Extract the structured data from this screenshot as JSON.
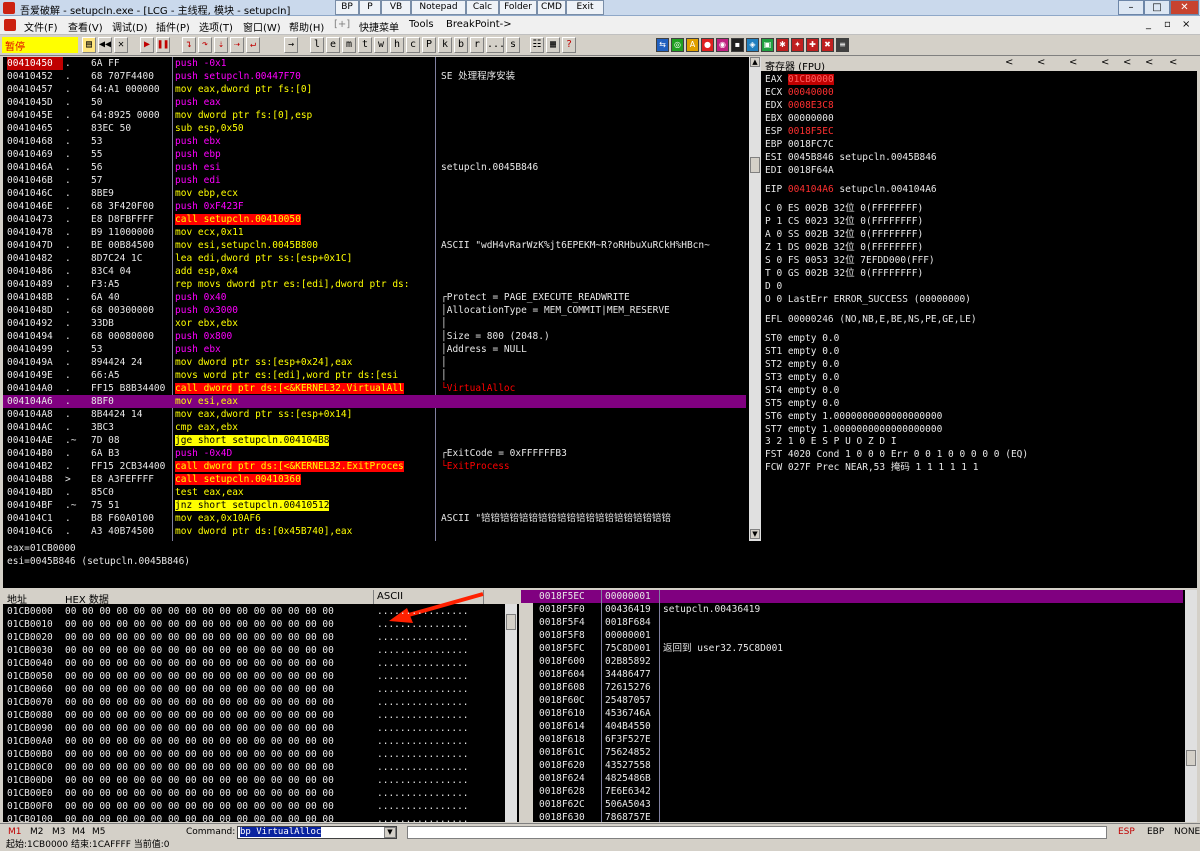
{
  "window": {
    "title": "吾爱破解 - setupcln.exe - [LCG - 主线程, 模块 - setupcln]",
    "quick_buttons": [
      "BP",
      "P",
      "VB",
      "Notepad",
      "Calc",
      "Folder",
      "CMD",
      "Exit"
    ],
    "controls": [
      "–",
      "□",
      "✕"
    ],
    "child_controls": [
      "_",
      "▫",
      "×"
    ]
  },
  "menu": [
    "文件(F)",
    "查看(V)",
    "调试(D)",
    "插件(P)",
    "选项(T)",
    "窗口(W)",
    "帮助(H)",
    "[+]",
    "快捷菜单",
    "Tools",
    "BreakPoint->"
  ],
  "toolbar": {
    "state": "暂停",
    "letters": [
      "l",
      "e",
      "m",
      "t",
      "w",
      "h",
      "c",
      "P",
      "k",
      "b",
      "r",
      "...",
      "s"
    ]
  },
  "disasm": [
    {
      "addr": "00410450",
      "mark": ".",
      "hex": "6A FF",
      "dis": "push -0x1",
      "type": "push",
      "cmt": "",
      "eip": true
    },
    {
      "addr": "00410452",
      "mark": ".",
      "hex": "68 707F4400",
      "dis": "push setupcln.00447F70",
      "type": "push",
      "cmt": "SE 处理程序安装"
    },
    {
      "addr": "00410457",
      "mark": ".",
      "hex": "64:A1 000000",
      "dis": "mov eax,dword ptr fs:[0]",
      "type": "mov",
      "cmt": ""
    },
    {
      "addr": "0041045D",
      "mark": ".",
      "hex": "50",
      "dis": "push eax",
      "type": "push",
      "cmt": ""
    },
    {
      "addr": "0041045E",
      "mark": ".",
      "hex": "64:8925 0000",
      "dis": "mov dword ptr fs:[0],esp",
      "type": "mov",
      "cmt": ""
    },
    {
      "addr": "00410465",
      "mark": ".",
      "hex": "83EC 50",
      "dis": "sub esp,0x50",
      "type": "misc",
      "cmt": ""
    },
    {
      "addr": "00410468",
      "mark": ".",
      "hex": "53",
      "dis": "push ebx",
      "type": "push",
      "cmt": ""
    },
    {
      "addr": "00410469",
      "mark": ".",
      "hex": "55",
      "dis": "push ebp",
      "type": "push",
      "cmt": ""
    },
    {
      "addr": "0041046A",
      "mark": ".",
      "hex": "56",
      "dis": "push esi",
      "type": "push",
      "cmt": "setupcln.0045B846"
    },
    {
      "addr": "0041046B",
      "mark": ".",
      "hex": "57",
      "dis": "push edi",
      "type": "push",
      "cmt": ""
    },
    {
      "addr": "0041046C",
      "mark": ".",
      "hex": "8BE9",
      "dis": "mov ebp,ecx",
      "type": "mov",
      "cmt": ""
    },
    {
      "addr": "0041046E",
      "mark": ".",
      "hex": "68 3F420F00",
      "dis": "push 0xF423F",
      "type": "push",
      "cmt": ""
    },
    {
      "addr": "00410473",
      "mark": ".",
      "hex": "E8 D8FBFFFF",
      "dis": "call setupcln.00410050",
      "type": "call",
      "cmt": ""
    },
    {
      "addr": "00410478",
      "mark": ".",
      "hex": "B9 11000000",
      "dis": "mov ecx,0x11",
      "type": "mov",
      "cmt": ""
    },
    {
      "addr": "0041047D",
      "mark": ".",
      "hex": "BE 00B84500",
      "dis": "mov esi,setupcln.0045B800",
      "type": "mov",
      "cmt": "ASCII \"wdH4vRarWzK%jt6EPEKM~R?oRHbuXuRCkH%HBcn~"
    },
    {
      "addr": "00410482",
      "mark": ".",
      "hex": "8D7C24 1C",
      "dis": "lea edi,dword ptr ss:[esp+0x1C]",
      "type": "mov",
      "cmt": ""
    },
    {
      "addr": "00410486",
      "mark": ".",
      "hex": "83C4 04",
      "dis": "add esp,0x4",
      "type": "misc",
      "cmt": ""
    },
    {
      "addr": "00410489",
      "mark": ".",
      "hex": "F3:A5",
      "dis": "rep movs dword ptr es:[edi],dword ptr ds:",
      "type": "mov",
      "cmt": ""
    },
    {
      "addr": "0041048B",
      "mark": ".",
      "hex": "6A 40",
      "dis": "push 0x40",
      "type": "push",
      "cmt": "┌Protect = PAGE_EXECUTE_READWRITE"
    },
    {
      "addr": "0041048D",
      "mark": ".",
      "hex": "68 00300000",
      "dis": "push 0x3000",
      "type": "push",
      "cmt": "│AllocationType = MEM_COMMIT|MEM_RESERVE"
    },
    {
      "addr": "00410492",
      "mark": ".",
      "hex": "33DB",
      "dis": "xor ebx,ebx",
      "type": "misc",
      "cmt": "│"
    },
    {
      "addr": "00410494",
      "mark": ".",
      "hex": "68 00080000",
      "dis": "push 0x800",
      "type": "push",
      "cmt": "│Size = 800 (2048.)"
    },
    {
      "addr": "00410499",
      "mark": ".",
      "hex": "53",
      "dis": "push ebx",
      "type": "push",
      "cmt": "│Address = NULL"
    },
    {
      "addr": "0041049A",
      "mark": ".",
      "hex": "894424 24",
      "dis": "mov dword ptr ss:[esp+0x24],eax",
      "type": "mov",
      "cmt": "│"
    },
    {
      "addr": "0041049E",
      "mark": ".",
      "hex": "66:A5",
      "dis": "movs word ptr es:[edi],word ptr ds:[esi",
      "type": "mov",
      "cmt": "│"
    },
    {
      "addr": "004104A0",
      "mark": ".",
      "hex": "FF15 B8B34400",
      "dis": "call dword ptr ds:[<&KERNEL32.VirtualAll",
      "type": "call",
      "cmt": "└VirtualAlloc",
      "cmtred": true
    },
    {
      "addr": "004104A6",
      "mark": ".",
      "hex": "8BF0",
      "dis": "mov esi,eax",
      "type": "mov",
      "cmt": "",
      "sel": true
    },
    {
      "addr": "004104A8",
      "mark": ".",
      "hex": "8B4424 14",
      "dis": "mov eax,dword ptr ss:[esp+0x14]",
      "type": "mov",
      "cmt": ""
    },
    {
      "addr": "004104AC",
      "mark": ".",
      "hex": "3BC3",
      "dis": "cmp eax,ebx",
      "type": "misc",
      "cmt": ""
    },
    {
      "addr": "004104AE",
      "mark": ".~",
      "hex": "7D 08",
      "dis": "jge short setupcln.004104B8",
      "type": "jmp",
      "cmt": ""
    },
    {
      "addr": "004104B0",
      "mark": ".",
      "hex": "6A B3",
      "dis": "push -0x4D",
      "type": "push",
      "cmt": "┌ExitCode = 0xFFFFFFB3"
    },
    {
      "addr": "004104B2",
      "mark": ".",
      "hex": "FF15 2CB34400",
      "dis": "call dword ptr ds:[<&KERNEL32.ExitProces",
      "type": "call",
      "cmt": "└ExitProcess",
      "cmtred": true
    },
    {
      "addr": "004104B8",
      "mark": ">",
      "hex": "E8 A3FEFFFF",
      "dis": "call setupcln.00410360",
      "type": "call",
      "cmt": ""
    },
    {
      "addr": "004104BD",
      "mark": ".",
      "hex": "85C0",
      "dis": "test eax,eax",
      "type": "misc",
      "cmt": ""
    },
    {
      "addr": "004104BF",
      "mark": ".~",
      "hex": "75 51",
      "dis": "jnz short setupcln.00410512",
      "type": "jmp",
      "cmt": ""
    },
    {
      "addr": "004104C1",
      "mark": ".",
      "hex": "B8 F60A0100",
      "dis": "mov eax,0x10AF6",
      "type": "mov",
      "cmt": "ASCII \"锫锫锫锫锫锫锫锫锫锫锫锫锫锫锫锫锫锫锫锫"
    },
    {
      "addr": "004104C6",
      "mark": ".",
      "hex": "A3 40B74500",
      "dis": "mov dword ptr ds:[0x45B740],eax",
      "type": "mov",
      "cmt": ""
    }
  ],
  "info": [
    "eax=01CB0000",
    "esi=0045B846 (setupcln.0045B846)"
  ],
  "registers": {
    "header": "寄存器 (FPU)",
    "nav": [
      "<",
      "<",
      "<",
      "<",
      "<",
      "<",
      "<"
    ],
    "gp": [
      {
        "name": "EAX",
        "val": "01CB0000",
        "style": "hl",
        "extra": ""
      },
      {
        "name": "ECX",
        "val": "00040000",
        "style": "red",
        "extra": ""
      },
      {
        "name": "EDX",
        "val": "0008E3C8",
        "style": "red",
        "extra": ""
      },
      {
        "name": "EBX",
        "val": "00000000",
        "style": "",
        "extra": ""
      },
      {
        "name": "ESP",
        "val": "0018F5EC",
        "style": "red",
        "extra": ""
      },
      {
        "name": "EBP",
        "val": "0018FC7C",
        "style": "",
        "extra": ""
      },
      {
        "name": "ESI",
        "val": "0045B846",
        "style": "",
        "extra": "setupcln.0045B846"
      },
      {
        "name": "EDI",
        "val": "0018F64A",
        "style": "",
        "extra": ""
      }
    ],
    "eip": {
      "name": "EIP",
      "val": "004104A6",
      "extra": "setupcln.004104A6"
    },
    "flags": [
      "C 0  ES 002B 32位 0(FFFFFFFF)",
      "P 1  CS 0023 32位 0(FFFFFFFF)",
      "A 0  SS 002B 32位 0(FFFFFFFF)",
      "Z 1  DS 002B 32位 0(FFFFFFFF)",
      "S 0  FS 0053 32位 7EFDD000(FFF)",
      "T 0  GS 002B 32位 0(FFFFFFFF)",
      "D 0",
      "O 0  LastErr ERROR_SUCCESS (00000000)"
    ],
    "efl": "EFL 00000246 (NO,NB,E,BE,NS,PE,GE,LE)",
    "fpu": [
      "ST0 empty 0.0",
      "ST1 empty 0.0",
      "ST2 empty 0.0",
      "ST3 empty 0.0",
      "ST4 empty 0.0",
      "ST5 empty 0.0",
      "ST6 empty 1.0000000000000000000",
      "ST7 empty 1.0000000000000000000"
    ],
    "fpu_bits": "              3 2 1 0       E S P U O Z D I",
    "fst": "FST 4020  Cond 1 0 0 0  Err 0 0 1 0 0 0 0 0  (EQ)",
    "fcw": "FCW 027F  Prec NEAR,53  掩码    1 1 1 1 1 1"
  },
  "dump": {
    "headers": [
      "地址",
      "HEX 数据",
      "ASCII"
    ],
    "hex": "00 00 00 00 00 00 00 00 00 00 00 00 00 00 00 00",
    "ascii": "................",
    "addrs": [
      "01CB0000",
      "01CB0010",
      "01CB0020",
      "01CB0030",
      "01CB0040",
      "01CB0050",
      "01CB0060",
      "01CB0070",
      "01CB0080",
      "01CB0090",
      "01CB00A0",
      "01CB00B0",
      "01CB00C0",
      "01CB00D0",
      "01CB00E0",
      "01CB00F0",
      "01CB0100"
    ]
  },
  "stack": [
    {
      "a": "0018F5EC",
      "v": "00000001",
      "c": "",
      "top": true
    },
    {
      "a": "0018F5F0",
      "v": "00436419",
      "c": "setupcln.00436419"
    },
    {
      "a": "0018F5F4",
      "v": "0018F684",
      "c": ""
    },
    {
      "a": "0018F5F8",
      "v": "00000001",
      "c": ""
    },
    {
      "a": "0018F5FC",
      "v": "75C8D001",
      "c": "返回到 user32.75C8D001"
    },
    {
      "a": "0018F600",
      "v": "02B85892",
      "c": ""
    },
    {
      "a": "0018F604",
      "v": "34486477",
      "c": ""
    },
    {
      "a": "0018F608",
      "v": "72615276",
      "c": ""
    },
    {
      "a": "0018F60C",
      "v": "25487057",
      "c": ""
    },
    {
      "a": "0018F610",
      "v": "4536746A",
      "c": ""
    },
    {
      "a": "0018F614",
      "v": "404B4550",
      "c": ""
    },
    {
      "a": "0018F618",
      "v": "6F3F527E",
      "c": ""
    },
    {
      "a": "0018F61C",
      "v": "75624852",
      "c": ""
    },
    {
      "a": "0018F620",
      "v": "43527558",
      "c": ""
    },
    {
      "a": "0018F624",
      "v": "4825486B",
      "c": ""
    },
    {
      "a": "0018F628",
      "v": "7E6E6342",
      "c": ""
    },
    {
      "a": "0018F62C",
      "v": "506A5043",
      "c": ""
    },
    {
      "a": "0018F630",
      "v": "7868757E",
      "c": ""
    }
  ],
  "cmdbar": {
    "marks": [
      "M1",
      "M2",
      "M3",
      "M4",
      "M5"
    ],
    "label": "Command:",
    "value": "bp VirtualAlloc",
    "right": [
      "ESP",
      "EBP",
      "NONE"
    ]
  },
  "status": "起始:1CB0000 结束:1CAFFFF 当前值:0"
}
